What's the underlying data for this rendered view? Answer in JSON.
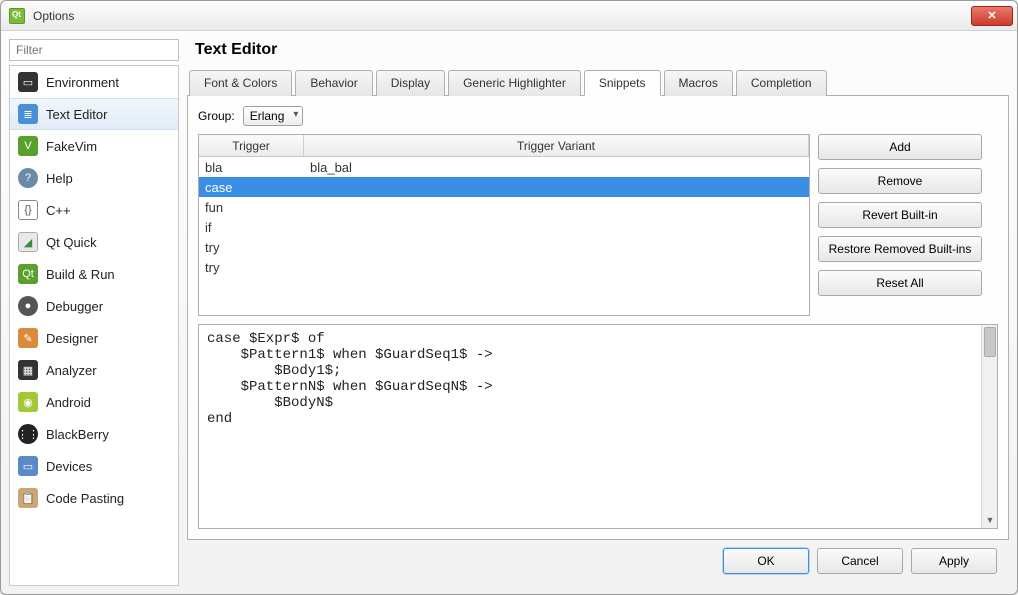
{
  "window": {
    "title": "Options"
  },
  "filter_placeholder": "Filter",
  "sidebar": {
    "items": [
      {
        "label": "Environment",
        "icon": "env"
      },
      {
        "label": "Text Editor",
        "icon": "text",
        "selected": true
      },
      {
        "label": "FakeVim",
        "icon": "fake"
      },
      {
        "label": "Help",
        "icon": "help"
      },
      {
        "label": "C++",
        "icon": "cpp"
      },
      {
        "label": "Qt Quick",
        "icon": "qtq"
      },
      {
        "label": "Build & Run",
        "icon": "build"
      },
      {
        "label": "Debugger",
        "icon": "dbg"
      },
      {
        "label": "Designer",
        "icon": "des"
      },
      {
        "label": "Analyzer",
        "icon": "ana"
      },
      {
        "label": "Android",
        "icon": "and"
      },
      {
        "label": "BlackBerry",
        "icon": "bb"
      },
      {
        "label": "Devices",
        "icon": "dev"
      },
      {
        "label": "Code Pasting",
        "icon": "paste"
      }
    ]
  },
  "page": {
    "title": "Text Editor"
  },
  "tabs": [
    {
      "label": "Font & Colors"
    },
    {
      "label": "Behavior"
    },
    {
      "label": "Display"
    },
    {
      "label": "Generic Highlighter"
    },
    {
      "label": "Snippets",
      "active": true
    },
    {
      "label": "Macros"
    },
    {
      "label": "Completion"
    }
  ],
  "group": {
    "label": "Group:",
    "value": "Erlang"
  },
  "table": {
    "headers": [
      "Trigger",
      "Trigger Variant"
    ],
    "rows": [
      {
        "trigger": "bla",
        "variant": "bla_bal"
      },
      {
        "trigger": "case",
        "variant": "",
        "selected": true
      },
      {
        "trigger": "fun",
        "variant": ""
      },
      {
        "trigger": "if",
        "variant": ""
      },
      {
        "trigger": "try",
        "variant": ""
      },
      {
        "trigger": "try",
        "variant": ""
      }
    ]
  },
  "buttons": {
    "add": "Add",
    "remove": "Remove",
    "revert": "Revert Built-in",
    "restore": "Restore Removed Built-ins",
    "reset": "Reset All"
  },
  "snippet_code": "case $Expr$ of\n    $Pattern1$ when $GuardSeq1$ ->\n        $Body1$;\n    $PatternN$ when $GuardSeqN$ ->\n        $BodyN$\nend",
  "footer": {
    "ok": "OK",
    "cancel": "Cancel",
    "apply": "Apply"
  }
}
